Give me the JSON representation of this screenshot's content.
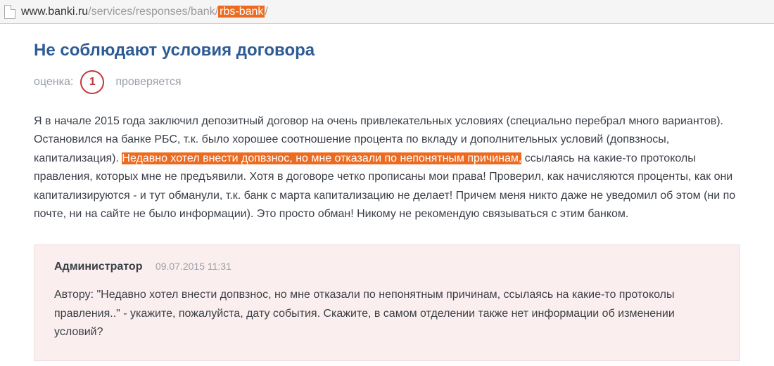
{
  "url": {
    "domain": "www.banki.ru",
    "path_before": "/services/responses/bank/",
    "highlighted": "rbs-bank",
    "path_after": "/"
  },
  "review": {
    "title": "Не соблюдают условия договора",
    "rating_label": "оценка:",
    "rating_value": "1",
    "status": "проверяется",
    "body_before": "Я в начале 2015 года заключил депозитный договор на очень привлекательных условиях (специально перебрал много вариантов). Остановился на банке РБС, т.к. было хорошее соотношение процента по вкладу и дополнительных условий (допвзносы, капитализация). ",
    "body_hl": "Недавно хотел внести допвзнос, но мне отказали по непонятным причинам,",
    "body_after": " ссылаясь на какие-то протоколы правления, которых мне не предъявили. Хотя в договоре четко прописаны мои права! Проверил, как начисляются проценты, как они капитализируются - и тут обманули, т.к. банк с марта капитализацию не делает! Причем меня никто даже не уведомил об этом (ни по почте, ни на сайте не было информации). Это просто обман! Никому не рекомендую связываться с этим банком."
  },
  "reply": {
    "author": "Администратор",
    "timestamp": "09.07.2015 11:31",
    "body": "Автору: \"Недавно хотел внести допвзнос, но мне отказали по непонятным причинам, ссылаясь на какие-то протоколы правления..\" - укажите, пожалуйста, дату события. Скажите, в самом отделении также нет информации об изменении условий?"
  }
}
